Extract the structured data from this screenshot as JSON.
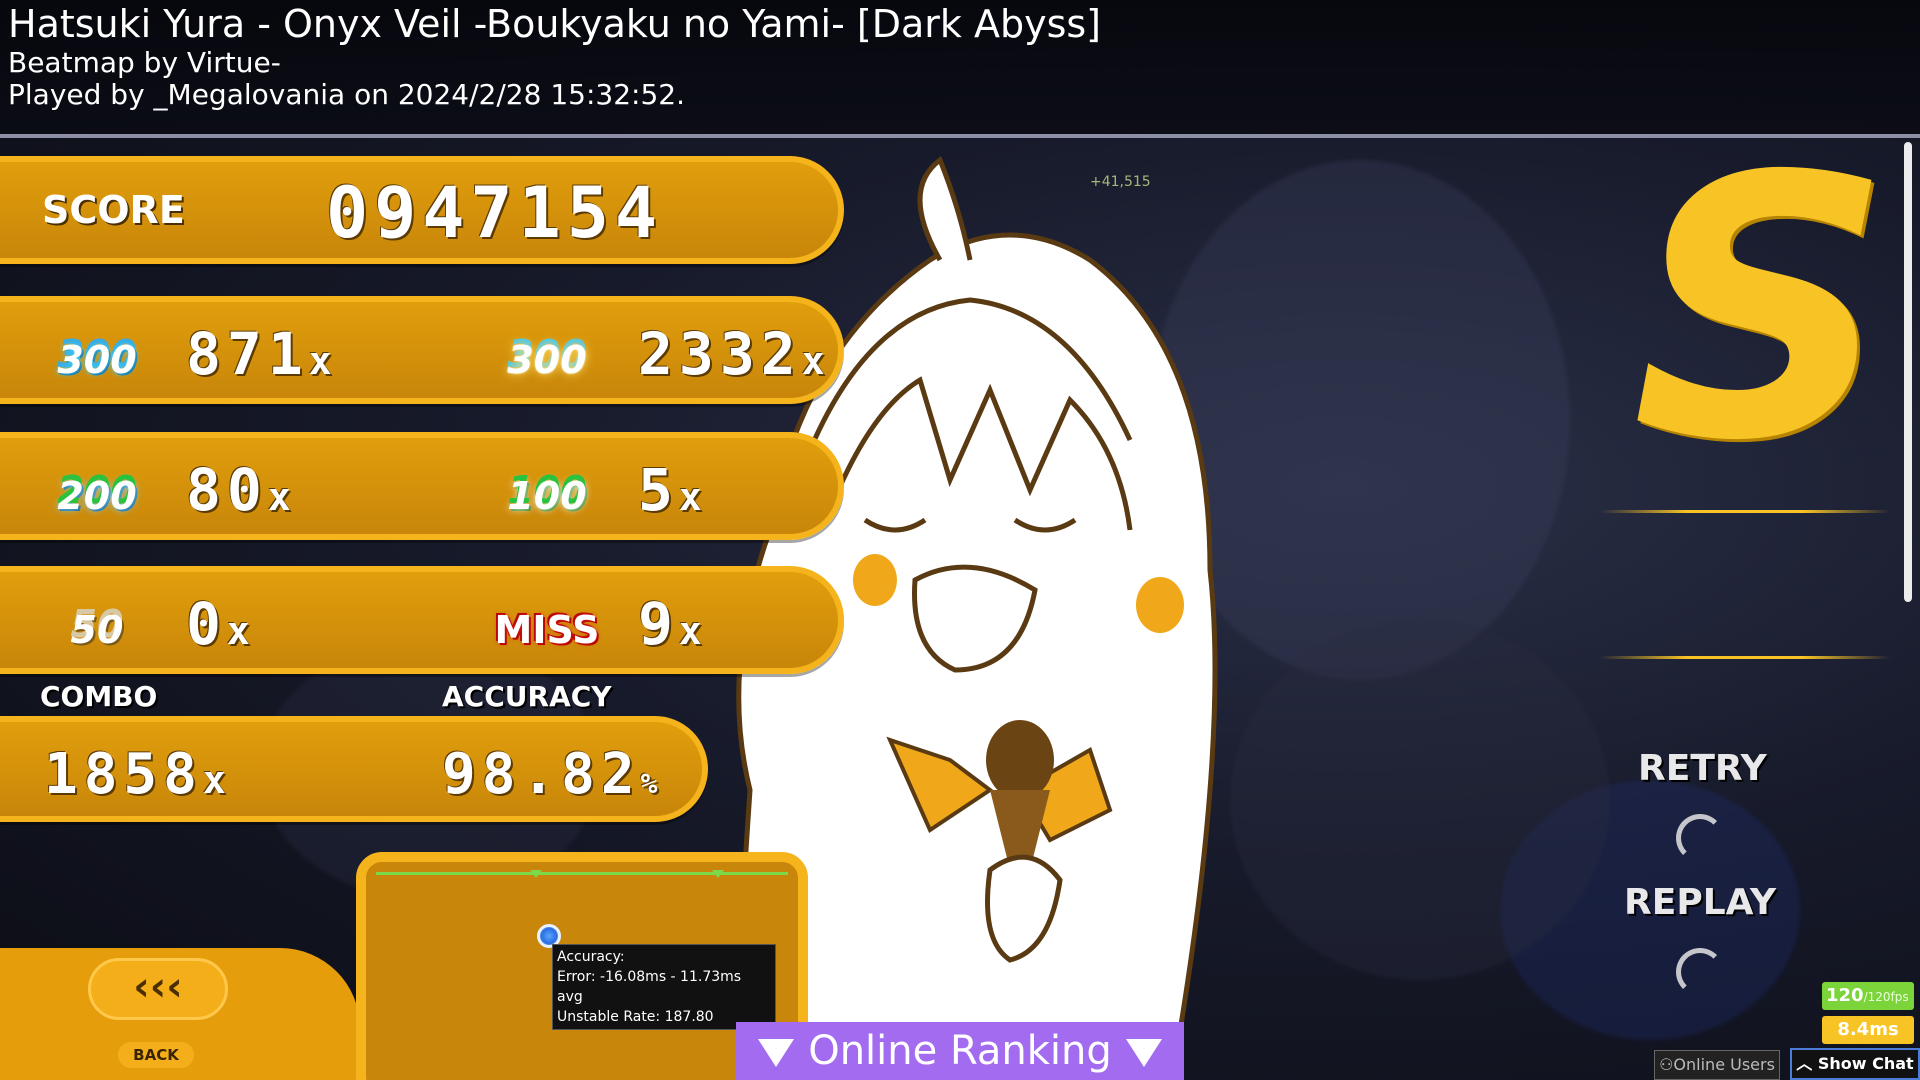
{
  "header": {
    "title": "Hatsuki Yura - Onyx Veil -Boukyaku no Yami- [Dark Abyss]",
    "mapper": "Beatmap by Virtue-",
    "played": "Played by _Megalovania on 2024/2/28 15:32:52."
  },
  "score": {
    "label": "SCORE",
    "value": "0947154"
  },
  "hits": {
    "h300": {
      "label": "300",
      "count": "871"
    },
    "geki": {
      "label": "300",
      "count": "2332"
    },
    "h200": {
      "label": "200",
      "count": "80"
    },
    "h100": {
      "label": "100",
      "count": "5"
    },
    "h50": {
      "label": "50",
      "count": "0"
    },
    "miss": {
      "label": "MISS",
      "count": "9"
    },
    "x_suffix": "x"
  },
  "combo": {
    "label": "COMBO",
    "value": "1858",
    "suffix": "x"
  },
  "accuracy": {
    "label": "ACCURACY",
    "value": "98.82",
    "suffix": "%"
  },
  "graph_tooltip": {
    "line1": "Accuracy:",
    "line2": "Error: -16.08ms - 11.73ms avg",
    "line3": "Unstable Rate: 187.80"
  },
  "pp_delta": "+41,515",
  "grade": "S",
  "buttons": {
    "retry": "RETRY",
    "replay": "REPLAY",
    "back_arrows": "‹‹‹",
    "back": "BACK",
    "online_ranking": "Online Ranking",
    "online_users": "Online Users",
    "show_chat": "Show Chat"
  },
  "perf": {
    "fps": "120",
    "fps_limit": "/120fps",
    "frame_time": "8.4ms"
  },
  "colors": {
    "panel": "#e19e0c",
    "panel_border": "#f5b31c",
    "grade": "#f7c325",
    "ranking_bar": "#a36cf0"
  },
  "icons": [
    "chevron-left-icon",
    "triangle-down-icon",
    "users-icon",
    "chevron-up-icon",
    "spinner-icon"
  ]
}
